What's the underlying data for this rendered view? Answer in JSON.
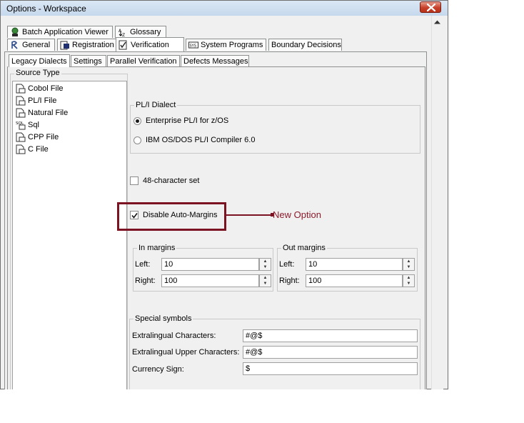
{
  "window": {
    "title": "Options - Workspace"
  },
  "tabs_row1": [
    {
      "label": "Batch Application Viewer",
      "icon": "batch-viewer-icon"
    },
    {
      "label": "Glossary",
      "icon": "glossary-icon"
    }
  ],
  "tabs_row2": [
    {
      "label": "General",
      "icon": "general-icon"
    },
    {
      "label": "Registration",
      "icon": "registration-icon"
    },
    {
      "label": "Verification",
      "icon": "verification-icon",
      "active": true
    },
    {
      "label": "System Programs",
      "icon": "system-programs-icon"
    },
    {
      "label": "Boundary Decisions",
      "icon": ""
    }
  ],
  "subtabs": [
    {
      "label": "Legacy Dialects",
      "active": true
    },
    {
      "label": "Settings"
    },
    {
      "label": "Parallel Verification"
    },
    {
      "label": "Defects Messages"
    }
  ],
  "source_type": {
    "legend": "Source Type",
    "items": [
      "Cobol File",
      "PL/I File",
      "Natural File",
      "Sql",
      "CPP File",
      "C File"
    ],
    "selected": "PL/I File"
  },
  "dialect": {
    "legend": "PL/I Dialect",
    "options": [
      "Enterprise PL/I for z/OS",
      "IBM OS/DOS PL/I Compiler 6.0"
    ],
    "selected": "Enterprise PL/I for z/OS"
  },
  "char_set_label": "48-character set",
  "char_set_checked": false,
  "auto_margins_label": "Disable Auto-Margins",
  "auto_margins_checked": true,
  "in_margins": {
    "legend": "In margins",
    "left_label": "Left:",
    "left_value": "10",
    "right_label": "Right:",
    "right_value": "100"
  },
  "out_margins": {
    "legend": "Out margins",
    "left_label": "Left:",
    "left_value": "10",
    "right_label": "Right:",
    "right_value": "100"
  },
  "special_symbols": {
    "legend": "Special symbols",
    "rows": [
      {
        "label": "Extralingual Characters:",
        "value": "#@$"
      },
      {
        "label": "Extralingual Upper Characters:",
        "value": "#@$"
      },
      {
        "label": "Currency Sign:",
        "value": "$"
      }
    ]
  },
  "callout": {
    "text": "New Option"
  },
  "colors": {
    "accent": "#7b1322",
    "callout_text": "#8b1a2b",
    "panel": "#f0f0f0",
    "titlebar": "#c5d8ec",
    "close": "#c7402a"
  }
}
